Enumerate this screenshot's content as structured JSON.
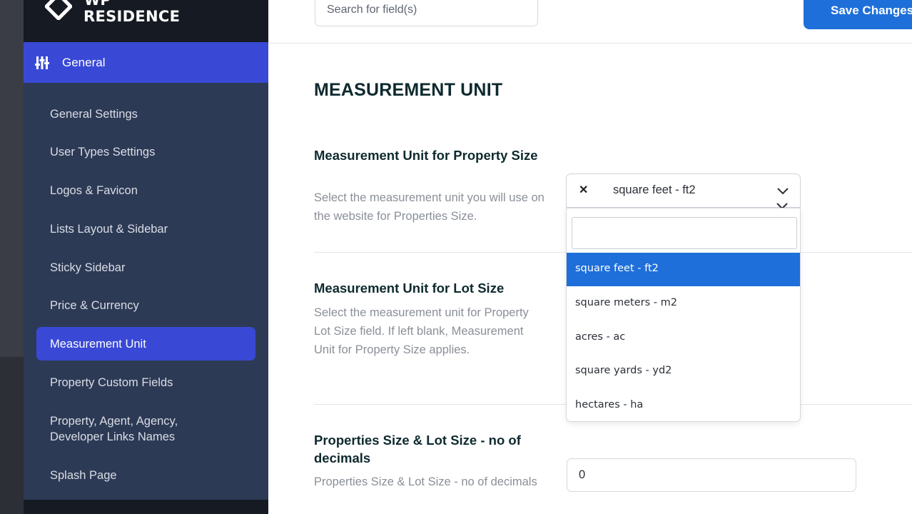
{
  "brand": {
    "logo_top": "WP",
    "logo_name": "RESIDENCE"
  },
  "sidebar": {
    "section_label": "General",
    "items": [
      {
        "label": "General Settings"
      },
      {
        "label": "User Types Settings"
      },
      {
        "label": "Logos & Favicon"
      },
      {
        "label": "Lists Layout & Sidebar"
      },
      {
        "label": "Sticky Sidebar"
      },
      {
        "label": "Price & Currency"
      },
      {
        "label": "Measurement Unit",
        "active": true
      },
      {
        "label": "Property Custom Fields"
      },
      {
        "label": "Property, Agent, Agency, Developer Links Names"
      },
      {
        "label": "Splash Page"
      }
    ]
  },
  "header": {
    "search_placeholder": "Search for field(s)",
    "save_label": "Save Changes"
  },
  "main": {
    "title": "MEASUREMENT UNIT",
    "fields": [
      {
        "title": "Measurement Unit for Property Size",
        "description": "Select the measurement unit you will use on the website for Properties Size.",
        "selected": "square feet - ft2"
      },
      {
        "title": "Measurement Unit for Lot Size",
        "description": "Select the measurement unit for Property Lot Size field. If left blank, Measurement Unit for Property Size applies."
      },
      {
        "title": "Properties Size & Lot Size - no of decimals",
        "description": "Properties Size & Lot Size - no of decimals",
        "value": "0"
      }
    ],
    "dropdown": {
      "search_value": "",
      "options": [
        "square feet - ft2",
        "square meters - m2",
        "acres - ac",
        "square yards - yd2",
        "hectares - ha"
      ]
    }
  },
  "colors": {
    "accent": "#3949d6",
    "sidebar_bg": "#2d3a55",
    "primary_button": "#1e6fd9",
    "heading": "#0e2a2f"
  },
  "icons": {
    "sections": "sliders-icon",
    "clear": "close-icon",
    "expand": "chevron-down-icon"
  }
}
